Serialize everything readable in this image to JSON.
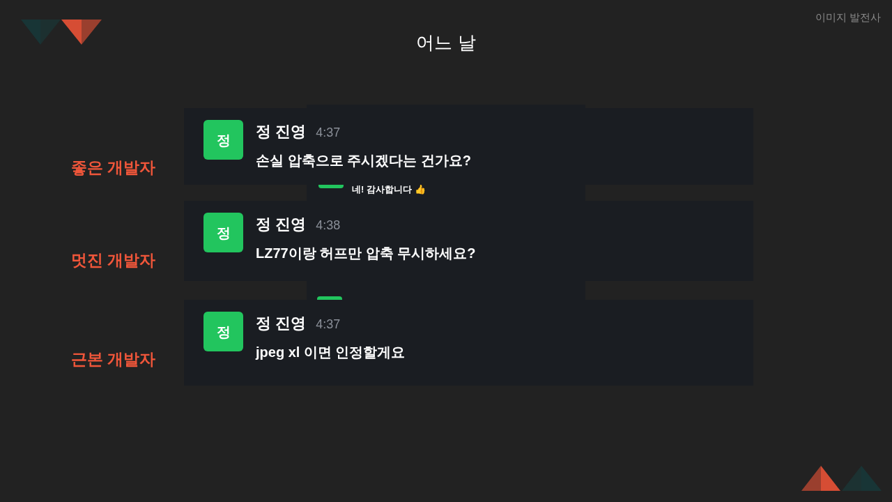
{
  "brand": "이미지 발전사",
  "title": "어느 날",
  "background_chat": {
    "message": "네! 감사합니다 👍"
  },
  "rows": [
    {
      "label": "좋은 개발자",
      "avatar": "정",
      "name": "정 진영",
      "time": "4:37",
      "message": "손실 압축으로 주시겠다는 건가요?"
    },
    {
      "label": "멋진 개발자",
      "avatar": "정",
      "name": "정 진영",
      "time": "4:38",
      "message": "LZ77이랑 허프만 압축 무시하세요?"
    },
    {
      "label": "근본 개발자",
      "avatar": "정",
      "name": "정 진영",
      "time": "4:37",
      "message": "jpeg xl 이면 인정할게요"
    }
  ]
}
